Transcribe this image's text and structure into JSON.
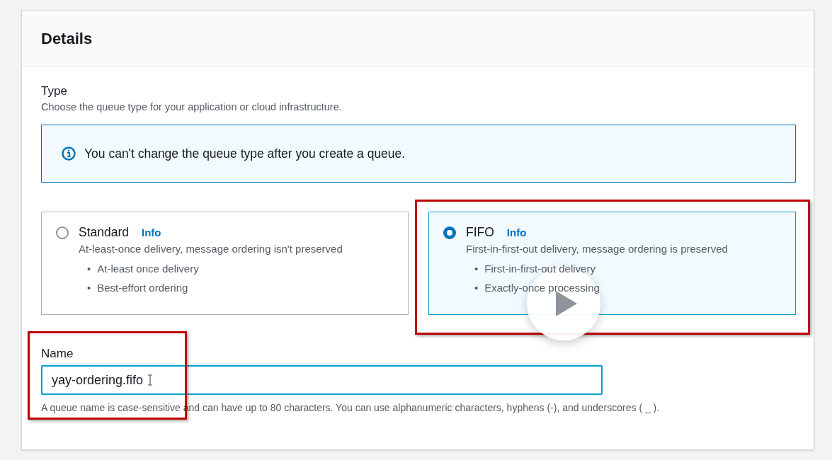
{
  "panel": {
    "title": "Details"
  },
  "type_field": {
    "label": "Type",
    "description": "Choose the queue type for your application or cloud infrastructure.",
    "alert": "You can't change the queue type after you create a queue.",
    "options": [
      {
        "title": "Standard",
        "info": "Info",
        "description": "At-least-once delivery, message ordering isn't preserved",
        "bullets": [
          {
            "marker": "•",
            "text": "At-least once delivery"
          },
          {
            "marker": "•",
            "text": "Best-effort ordering"
          }
        ],
        "selected": false,
        "highlighted": false
      },
      {
        "title": "FIFO",
        "info": "Info",
        "description": "First-in-first-out delivery, message ordering is preserved",
        "bullets": [
          {
            "marker": "•",
            "text": "First-in-first-out delivery"
          },
          {
            "marker": "•",
            "text": "Exactly-once processing"
          }
        ],
        "selected": true,
        "highlighted": true,
        "play_overlay": true
      }
    ]
  },
  "name_field": {
    "label": "Name",
    "value": "yay-ordering.fifo",
    "hint": "A queue name is case-sensitive and can have up to 80 characters. You can use alphanumeric characters, hyphens (-), and underscores ( _ ).",
    "highlighted": true,
    "text_cursor": true
  }
}
